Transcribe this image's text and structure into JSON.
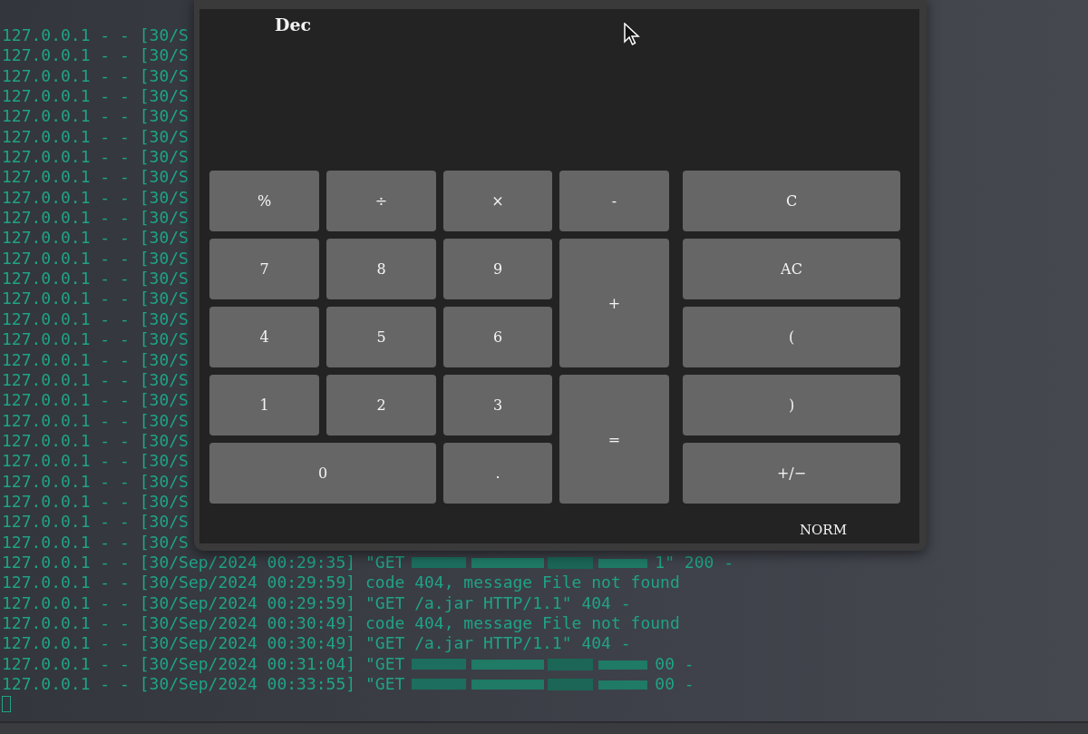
{
  "terminal": {
    "lines": [
      {
        "kind": "plain",
        "text": "127.0.0.1 - - [30/S"
      },
      {
        "kind": "plain",
        "text": "127.0.0.1 - - [30/S"
      },
      {
        "kind": "plain",
        "text": "127.0.0.1 - - [30/S"
      },
      {
        "kind": "plain",
        "text": "127.0.0.1 - - [30/S"
      },
      {
        "kind": "plain",
        "text": "127.0.0.1 - - [30/S"
      },
      {
        "kind": "plain",
        "text": "127.0.0.1 - - [30/S"
      },
      {
        "kind": "plain",
        "text": "127.0.0.1 - - [30/S"
      },
      {
        "kind": "plain",
        "text": "127.0.0.1 - - [30/S"
      },
      {
        "kind": "plain",
        "text": "127.0.0.1 - - [30/S"
      },
      {
        "kind": "plain",
        "text": "127.0.0.1 - - [30/S"
      },
      {
        "kind": "plain",
        "text": "127.0.0.1 - - [30/S"
      },
      {
        "kind": "plain",
        "text": "127.0.0.1 - - [30/S"
      },
      {
        "kind": "plain",
        "text": "127.0.0.1 - - [30/S"
      },
      {
        "kind": "plain",
        "text": "127.0.0.1 - - [30/S"
      },
      {
        "kind": "plain",
        "text": "127.0.0.1 - - [30/S"
      },
      {
        "kind": "plain",
        "text": "127.0.0.1 - - [30/S"
      },
      {
        "kind": "plain",
        "text": "127.0.0.1 - - [30/S"
      },
      {
        "kind": "plain",
        "text": "127.0.0.1 - - [30/S"
      },
      {
        "kind": "plain",
        "text": "127.0.0.1 - - [30/S"
      },
      {
        "kind": "plain",
        "text": "127.0.0.1 - - [30/S"
      },
      {
        "kind": "plain",
        "text": "127.0.0.1 - - [30/S"
      },
      {
        "kind": "plain",
        "text": "127.0.0.1 - - [30/S"
      },
      {
        "kind": "plain",
        "text": "127.0.0.1 - - [30/S"
      },
      {
        "kind": "plain",
        "text": "127.0.0.1 - - [30/S"
      },
      {
        "kind": "plain",
        "text": "127.0.0.1 - - [30/S"
      },
      {
        "kind": "plain",
        "text": "127.0.0.1 - - [30/S"
      },
      {
        "kind": "redacted",
        "text": "127.0.0.1 - - [30/Sep/2024 00:29:35] \"GET",
        "after": "1\" 200 -"
      },
      {
        "kind": "plain",
        "text": "127.0.0.1 - - [30/Sep/2024 00:29:59] code 404, message File not found"
      },
      {
        "kind": "plain",
        "text": "127.0.0.1 - - [30/Sep/2024 00:29:59] \"GET /a.jar HTTP/1.1\" 404 -"
      },
      {
        "kind": "plain",
        "text": "127.0.0.1 - - [30/Sep/2024 00:30:49] code 404, message File not found"
      },
      {
        "kind": "plain",
        "text": "127.0.0.1 - - [30/Sep/2024 00:30:49] \"GET /a.jar HTTP/1.1\" 404 -"
      },
      {
        "kind": "redacted",
        "text": "127.0.0.1 - - [30/Sep/2024 00:31:04] \"GET",
        "after": "00 -"
      },
      {
        "kind": "redacted",
        "text": "127.0.0.1 - - [30/Sep/2024 00:33:55] \"GET",
        "after": "00 -"
      }
    ]
  },
  "calculator": {
    "base": "Dec",
    "mode": "NORM",
    "keys": [
      {
        "label": "%",
        "kind": "normal"
      },
      {
        "label": "÷",
        "kind": "normal"
      },
      {
        "label": "×",
        "kind": "normal"
      },
      {
        "label": "-",
        "kind": "normal"
      },
      {
        "label": "C",
        "kind": "normal"
      },
      {
        "label": "7",
        "kind": "normal"
      },
      {
        "label": "8",
        "kind": "normal"
      },
      {
        "label": "9",
        "kind": "normal"
      },
      {
        "label": "+",
        "kind": "tall"
      },
      {
        "label": "AC",
        "kind": "normal"
      },
      {
        "label": "4",
        "kind": "normal"
      },
      {
        "label": "5",
        "kind": "normal"
      },
      {
        "label": "6",
        "kind": "normal"
      },
      {
        "label": "(",
        "kind": "normal"
      },
      {
        "label": "1",
        "kind": "normal"
      },
      {
        "label": "2",
        "kind": "normal"
      },
      {
        "label": "3",
        "kind": "normal"
      },
      {
        "label": "=",
        "kind": "tall"
      },
      {
        "label": ")",
        "kind": "normal"
      },
      {
        "label": "0",
        "kind": "wide"
      },
      {
        "label": ".",
        "kind": "normal"
      },
      {
        "label": "+/−",
        "kind": "normal"
      }
    ]
  }
}
